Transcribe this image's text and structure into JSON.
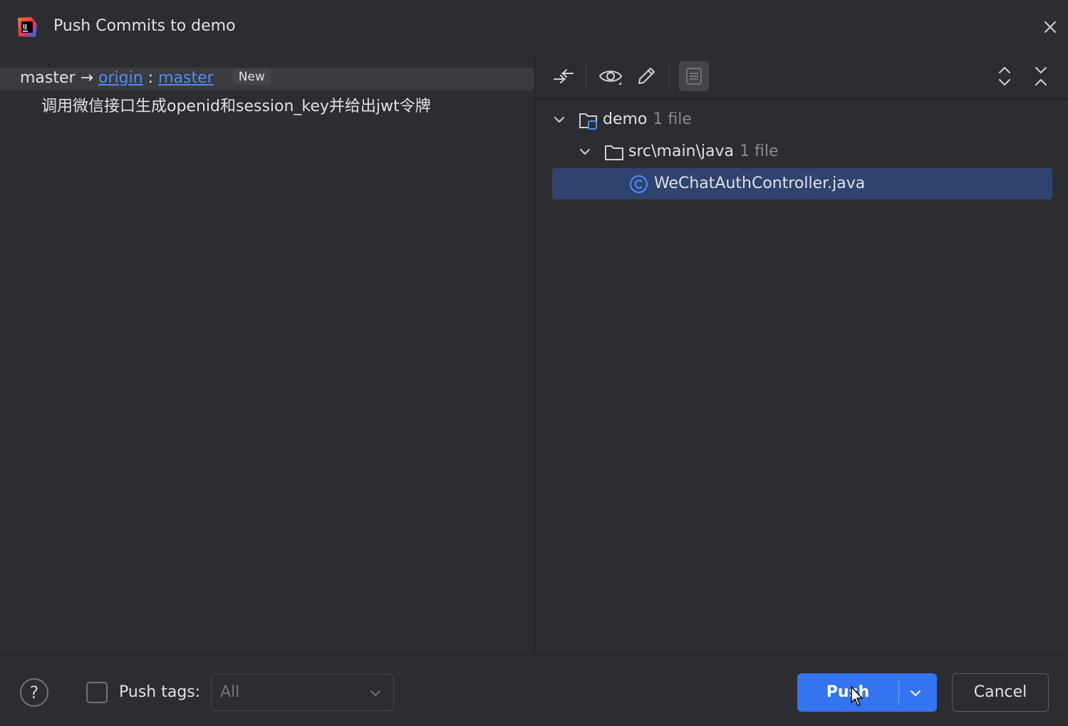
{
  "window": {
    "title": "Push Commits to demo",
    "app_icon": "intellij-idea-icon",
    "close_icon": "close-icon"
  },
  "commits_panel": {
    "branch": {
      "local": "master",
      "arrow": "→",
      "remote": "origin",
      "separator": ":",
      "remote_branch": "master",
      "badge": "New"
    },
    "commits": [
      {
        "message": "调用微信接口生成openid和session_key并给出jwt令牌"
      }
    ]
  },
  "changes_panel": {
    "toolbar": [
      {
        "name": "show-diff-icon"
      },
      {
        "name": "eye-icon"
      },
      {
        "name": "edit-icon"
      },
      {
        "name": "preview-details-icon",
        "active": true
      },
      {
        "name": "expand-all-icon"
      },
      {
        "name": "collapse-all-icon"
      }
    ],
    "tree": [
      {
        "label": "demo",
        "count": "1 file",
        "icon": "module-folder-icon",
        "expanded": true
      },
      {
        "label": "src\\main\\java",
        "count": "1 file",
        "icon": "folder-icon",
        "expanded": true
      },
      {
        "label": "WeChatAuthController.java",
        "icon": "java-class-icon",
        "selected": true
      }
    ]
  },
  "footer": {
    "help_label": "?",
    "push_tags_label": "Push tags:",
    "push_tags_checked": false,
    "push_tags_select_value": "All",
    "push_button": "Push",
    "cancel_button": "Cancel"
  },
  "colors": {
    "background": "#2b2d30",
    "accent": "#3574f0",
    "link": "#548af7",
    "selection": "#2e436e",
    "muted_text": "#868a91"
  }
}
